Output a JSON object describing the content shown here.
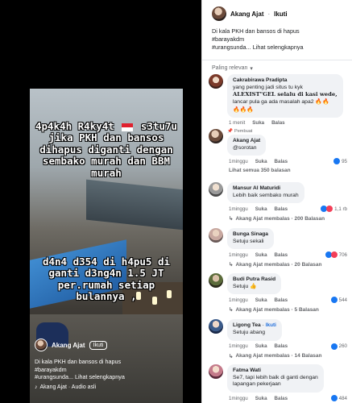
{
  "video": {
    "caption_top_1": "4p4k4h R4ky4t",
    "caption_top_2": "s3tu7u",
    "caption_top_3": "jika PKH dan bansos dihapus diganti dengan sembako murah dan BBM murah",
    "caption_bottom": "d4n4 d354 di h4pu5 di ganti d3ng4n 1.5 JT per.rumah setiap bulannya ,",
    "author": "Akang Ajat",
    "follow_label": "Ikuti",
    "description": [
      "Di kala PKH dan bansos di hapus",
      "#barayakdm",
      "#urangsunda... Lihat selengkapnya"
    ],
    "audio": "Akang Ajat · Audio asli"
  },
  "panel": {
    "author": "Akang Ajat",
    "follow_label": "Ikuti",
    "description": [
      "Di kala PKH dan bansos di hapus",
      "#barayakdm",
      "#urangsunda... Lihat selengkapnya"
    ],
    "sort_label": "Paling relevan"
  },
  "comments": [
    {
      "author": "Cakrabirawa Pradipta",
      "text_1": "yang penting jadi situs tu kyk",
      "text_2": "ALEXIST\"GEL selalu di kasi wede,",
      "text_3": "lancar pula ga ada masalah apa2",
      "time": "1 menit",
      "like": "Suka",
      "reply": "Balas"
    },
    {
      "pinned": "Pembuat",
      "author": "Akang Ajat",
      "mention": "@sorotan",
      "time": "1minggu",
      "like": "Suka",
      "reply": "Balas",
      "reactions": "95",
      "replies": "Lihat semua 350 balasan"
    },
    {
      "author": "Mansur Al Maturidi",
      "text": "Lebih baik sembako murah",
      "time": "1minggu",
      "like": "Suka",
      "reply": "Balas",
      "reactions": "1,1 rb",
      "replies": "Akang Ajat membalas · 200 Balasan"
    },
    {
      "author": "Bunga Sinaga",
      "text": "Setuju sekali",
      "time": "1minggu",
      "like": "Suka",
      "reply": "Balas",
      "reactions": "706",
      "replies": "Akang Ajat membalas · 20 Balasan"
    },
    {
      "author": "Budi Putra Rasid",
      "text": "Setuju",
      "time": "1minggu",
      "like": "Suka",
      "reply": "Balas",
      "reactions": "544",
      "replies": "Akang Ajat membalas · 5 Balasan"
    },
    {
      "author": "Ligong Tea",
      "follow": "Ikuti",
      "text": "Setuju abang",
      "time": "1minggu",
      "like": "Suka",
      "reply": "Balas",
      "reactions": "260",
      "replies": "Akang Ajat membalas · 14 Balasan"
    },
    {
      "author": "Fatma Wati",
      "text_1": "Se7, tapi lebih baik di ganti dengan",
      "text_2": "lapangan pekerjaan",
      "time": "1minggu",
      "like": "Suka",
      "reply": "Balas",
      "reactions": "484"
    }
  ],
  "colors": {
    "link": "#216fdb",
    "like": "#1877f2",
    "love": "#f33e58",
    "haha": "#f7b125"
  }
}
